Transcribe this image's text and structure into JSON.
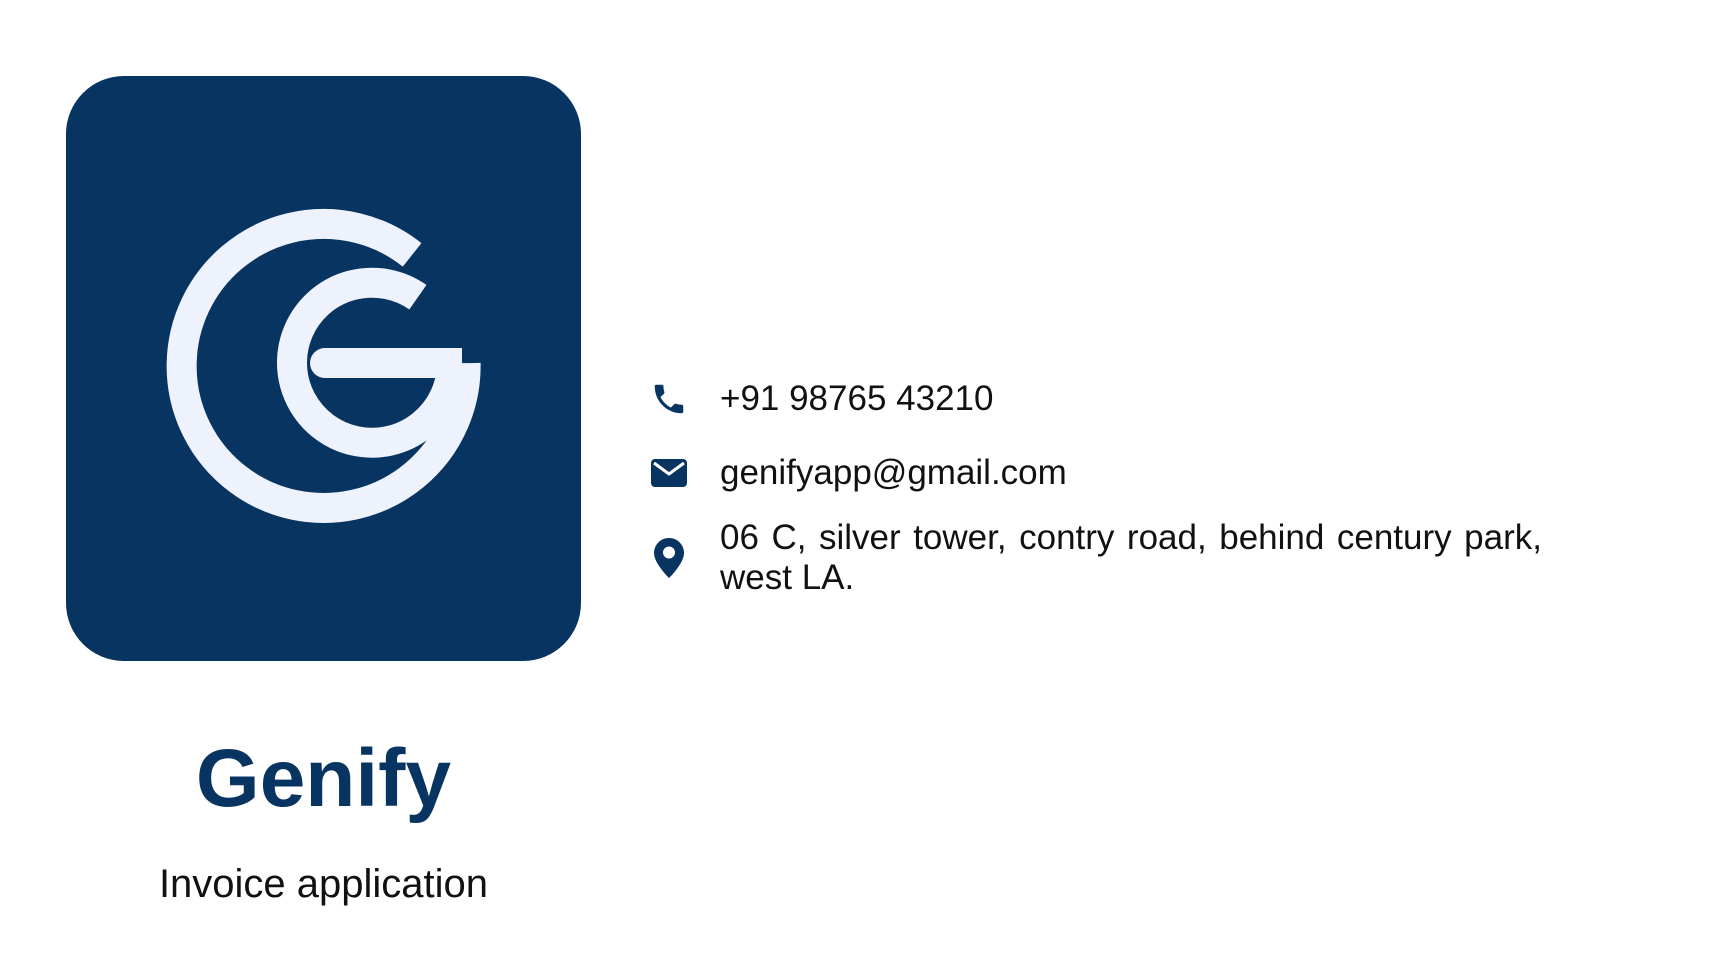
{
  "brand": {
    "name": "Genify",
    "tagline": "Invoice application",
    "logo_icon": "genify-g-logo-icon",
    "color_primary": "#073461",
    "color_logo_mark": "#EEF2FC"
  },
  "contact": {
    "phone": {
      "icon": "phone-icon",
      "value": "+91 98765 43210"
    },
    "email": {
      "icon": "envelope-icon",
      "value": "genifyapp@gmail.com"
    },
    "address": {
      "icon": "location-pin-icon",
      "value": "06 C, silver tower, contry road, behind century park, west LA."
    }
  }
}
